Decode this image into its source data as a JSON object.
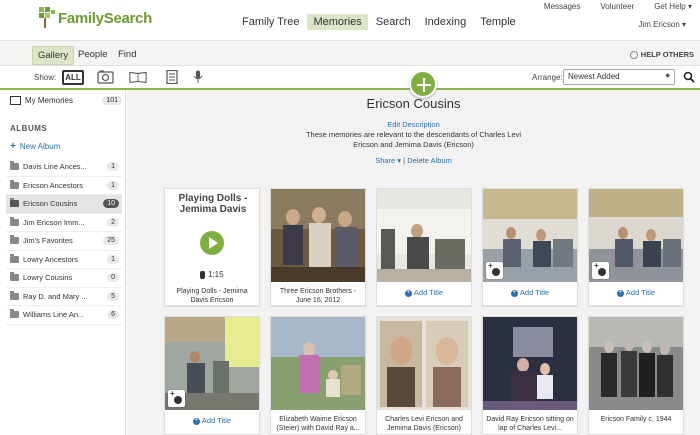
{
  "brand": {
    "name_a": "Family",
    "name_b": "Search"
  },
  "mainnav": [
    {
      "label": "Family Tree",
      "active": false
    },
    {
      "label": "Memories",
      "active": true
    },
    {
      "label": "Search",
      "active": false
    },
    {
      "label": "Indexing",
      "active": false
    },
    {
      "label": "Temple",
      "active": false
    }
  ],
  "usernav": {
    "messages": "Messages",
    "volunteer": "Volunteer",
    "help": "Get Help ▾",
    "user": "Jim Ericson ▾"
  },
  "subnav": {
    "tabs": [
      {
        "label": "Gallery"
      },
      {
        "label": "People"
      },
      {
        "label": "Find"
      }
    ],
    "help_others": "HELP OTHERS"
  },
  "filter": {
    "show_label": "Show:",
    "all_label": "ALL",
    "arrange_label": "Arrange:",
    "arrange_value": "Newest Added",
    "arrange_arrow": "◆"
  },
  "sidebar": {
    "my_memories": {
      "label": "My Memories",
      "count": "101"
    },
    "albums_heading": "ALBUMS",
    "new_album": "New Album",
    "albums": [
      {
        "label": "Davis Line Ances...",
        "count": "1"
      },
      {
        "label": "Ericson Ancestors",
        "count": "1"
      },
      {
        "label": "Ericson Cousins",
        "count": "10",
        "active": true
      },
      {
        "label": "Jim Ericson Imm...",
        "count": "2"
      },
      {
        "label": "Jim's Favorites",
        "count": "25"
      },
      {
        "label": "Lowry Ancestors",
        "count": "1"
      },
      {
        "label": "Lowry Cousins",
        "count": "0"
      },
      {
        "label": "Ray D. and Mary ...",
        "count": "5"
      },
      {
        "label": "Williams Line An...",
        "count": "6"
      }
    ]
  },
  "album": {
    "title": "Ericson Cousins",
    "edit_description": "Edit Description",
    "description": "These memories are relevant to the descendants of Charles Levi Ericson and Jemima Davis (Ericson)",
    "share": "Share ▾",
    "separator": "|",
    "delete": "Delete Album"
  },
  "cards": [
    {
      "title": "Playing Dolls - Jemima Davis",
      "duration": "1:15",
      "caption": "Playing Dolls - Jemima Davis Ericson"
    },
    {
      "caption": "Three Ericson Brothers - June 16, 2012"
    },
    {
      "caption": "Add Title"
    },
    {
      "caption": "Add Title"
    },
    {
      "caption": "Add Title"
    },
    {
      "caption": "Add Title"
    },
    {
      "caption": "Elizabeth Waime Ericson (Steier) with David Ray a..."
    },
    {
      "caption": "Charles Levi Ericson and Jemima Davis (Ericson)"
    },
    {
      "caption": "David Ray Ericson sitting on lap of Charles Levi..."
    },
    {
      "caption": "Ericson Family c. 1944"
    }
  ],
  "colors": {
    "accent": "#7fb03f",
    "link": "#2a6fb3",
    "active_tab": "#dde5c7"
  }
}
